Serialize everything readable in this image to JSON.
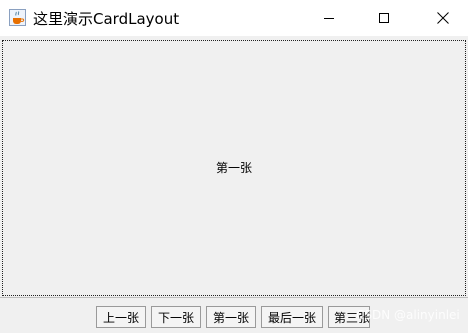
{
  "window": {
    "title": "这里演示CardLayout",
    "icon": "java-coffee-icon",
    "controls": [
      "minimize-icon",
      "maximize-icon",
      "close-icon"
    ]
  },
  "card": {
    "current_label": "第一张"
  },
  "buttons": {
    "prev": "上一张",
    "next": "下一张",
    "first": "第一张",
    "last": "最后一张",
    "third": "第三张"
  },
  "watermark": "CSDN @alinyinlei"
}
